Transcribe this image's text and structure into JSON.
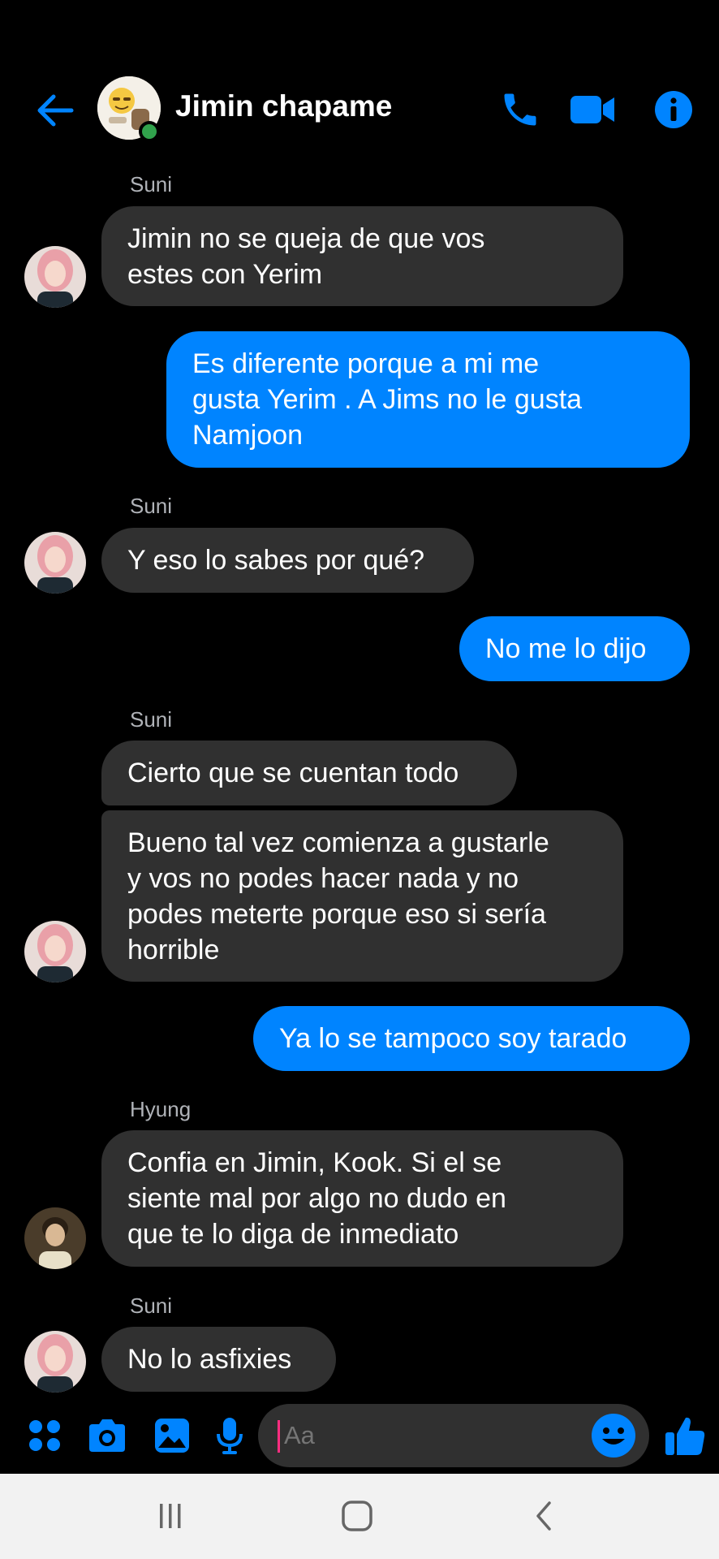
{
  "header": {
    "title": "Jimin chapame",
    "back_icon": "arrow-left-icon",
    "icons": [
      "phone-icon",
      "video-camera-icon",
      "info-icon"
    ],
    "accent_color": "#0084ff",
    "online_color": "#31a24c"
  },
  "messages": [
    {
      "sender": "Suni",
      "direction": "incoming",
      "lines": [
        "Jimin no se queja de que vos",
        "estes con Yerim"
      ]
    },
    {
      "direction": "outgoing",
      "lines": [
        "Es diferente porque a mi me",
        "gusta Yerim . A Jims no le gusta",
        "Namjoon"
      ]
    },
    {
      "sender": "Suni",
      "direction": "incoming",
      "lines": [
        "Y eso lo sabes por qué?"
      ]
    },
    {
      "direction": "outgoing",
      "lines": [
        "No me lo dijo"
      ]
    },
    {
      "sender": "Suni",
      "direction": "incoming",
      "lines": [
        "Cierto que se cuentan todo"
      ]
    },
    {
      "direction": "incoming",
      "lines": [
        "Bueno tal vez comienza a gustarle",
        "y vos no podes hacer nada y no",
        "podes meterte porque eso si sería",
        "horrible"
      ]
    },
    {
      "direction": "outgoing",
      "lines": [
        "Ya lo se tampoco soy tarado"
      ]
    },
    {
      "sender": "Hyung",
      "direction": "incoming",
      "lines": [
        "Confia en Jimin, Kook. Si el se",
        "siente mal por algo no dudo en",
        "que te lo diga de inmediato"
      ]
    },
    {
      "sender": "Suni",
      "direction": "incoming",
      "lines": [
        "No lo asfixies"
      ]
    }
  ],
  "composer": {
    "placeholder": "Aa",
    "icons": [
      "apps-grid-icon",
      "camera-icon",
      "gallery-icon",
      "microphone-icon",
      "emoji-icon",
      "thumbs-up-icon"
    ]
  },
  "navbar": {
    "icons": [
      "recents-icon",
      "home-icon",
      "back-icon"
    ]
  },
  "colors": {
    "background": "#000000",
    "incoming_bubble": "#303030",
    "outgoing_bubble": "#0084ff",
    "sender_name": "#b0b3b8"
  }
}
